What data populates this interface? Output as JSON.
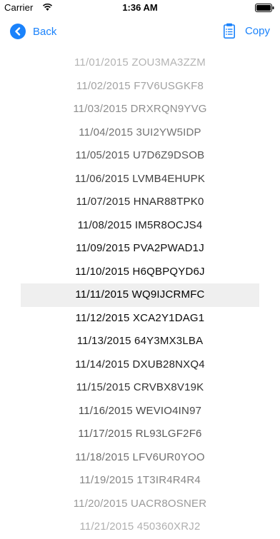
{
  "status_bar": {
    "carrier": "Carrier",
    "time": "1:36 AM",
    "wifi_icon": "wifi-icon",
    "battery_icon": "battery-full-icon"
  },
  "nav": {
    "back_label": "Back",
    "back_icon": "chevron-left-circle-icon",
    "copy_label": "Copy",
    "copy_icon": "clipboard-icon",
    "accent_color": "#1a82fb"
  },
  "codes": [
    {
      "text": "11/01/2015 ZOU3MA3ZZM",
      "color": "#b4b4b4"
    },
    {
      "text": "11/02/2015 F7V6USGKF8",
      "color": "#a2a2a2"
    },
    {
      "text": "11/03/2015 DRXRQN9YVG",
      "color": "#8e8e8e"
    },
    {
      "text": "11/04/2015 3UI2YW5IDP",
      "color": "#737373"
    },
    {
      "text": "11/05/2015 U7D6Z9DSOB",
      "color": "#585858"
    },
    {
      "text": "11/06/2015 LVMB4EHUPK",
      "color": "#404040"
    },
    {
      "text": "11/07/2015 HNAR88TPK0",
      "color": "#2c2c2c"
    },
    {
      "text": "11/08/2015 IM5R8OCJS4",
      "color": "#1c1c1c"
    },
    {
      "text": "11/09/2015 PVA2PWAD1J",
      "color": "#111111"
    },
    {
      "text": "11/10/2015 H6QBPQYD6J",
      "color": "#0a0a0a"
    },
    {
      "text": "11/11/2015 WQ9IJCRMFC",
      "color": "#000000",
      "highlighted": true
    },
    {
      "text": "11/12/2015 XCA2Y1DAG1",
      "color": "#0a0a0a"
    },
    {
      "text": "11/13/2015 64Y3MX3LBA",
      "color": "#141414"
    },
    {
      "text": "11/14/2015 DXUB28NXQ4",
      "color": "#222222"
    },
    {
      "text": "11/15/2015 CRVBX8V19K",
      "color": "#333333"
    },
    {
      "text": "11/16/2015 WEVIO4IN97",
      "color": "#484848"
    },
    {
      "text": "11/17/2015 RL93LGF2F6",
      "color": "#5c5c5c"
    },
    {
      "text": "11/18/2015 LFV6UR0YOO",
      "color": "#707070"
    },
    {
      "text": "11/19/2015 1T3IR4R4R4",
      "color": "#858585"
    },
    {
      "text": "11/20/2015 UACR8OSNER",
      "color": "#9a9a9a"
    },
    {
      "text": "11/21/2015 450360XRJ2",
      "color": "#b0b0b0"
    }
  ]
}
